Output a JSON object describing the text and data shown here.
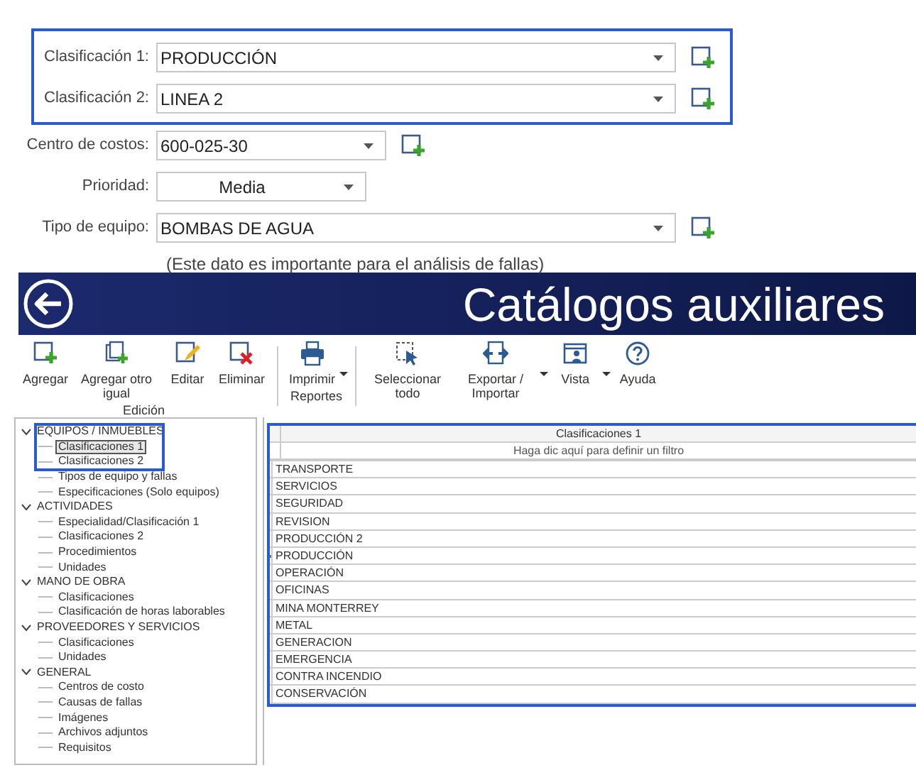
{
  "form": {
    "fields": [
      {
        "label": "Clasificación 1:",
        "value": "PRODUCCIÓN",
        "add_button": true,
        "highlighted": true
      },
      {
        "label": "Clasificación 2:",
        "value": "LINEA 2",
        "add_button": true,
        "highlighted": true
      },
      {
        "label": "Centro de costos:",
        "value": "600-025-30",
        "add_button": true,
        "highlighted": false
      },
      {
        "label": "Prioridad:",
        "value": "Media",
        "add_button": false,
        "highlighted": false
      },
      {
        "label": "Tipo de equipo:",
        "value": "BOMBAS DE AGUA",
        "add_button": true,
        "highlighted": false
      }
    ],
    "note": "(Este dato es importante para el análisis de fallas)"
  },
  "header": {
    "title": "Catálogos auxiliares"
  },
  "toolbar": {
    "groups": [
      {
        "label": "Edición",
        "buttons": [
          {
            "label": "Agregar",
            "has_menu": false
          },
          {
            "label": "Agregar otro igual",
            "has_menu": false
          },
          {
            "label": "Editar",
            "has_menu": false
          },
          {
            "label": "Eliminar",
            "has_menu": false
          }
        ]
      },
      {
        "label": "Reportes",
        "buttons": [
          {
            "label": "Imprimir",
            "has_menu": true
          }
        ]
      },
      {
        "buttons": [
          {
            "label": "Seleccionar todo",
            "has_menu": false
          },
          {
            "label": "Exportar / Importar",
            "has_menu": true
          },
          {
            "label": "Vista",
            "has_menu": true
          },
          {
            "label": "Ayuda",
            "has_menu": false
          }
        ]
      }
    ]
  },
  "tree": [
    {
      "label": "EQUIPOS / INMUEBLES",
      "expanded": true,
      "children": [
        {
          "label": "Clasificaciones 1",
          "selected": true,
          "highlighted": true
        },
        {
          "label": "Clasificaciones 2",
          "selected": false,
          "highlighted": true
        },
        {
          "label": "Tipos de equipo y fallas",
          "selected": false,
          "highlighted": false
        },
        {
          "label": "Especificaciones (Solo equipos)",
          "selected": false,
          "highlighted": false
        }
      ]
    },
    {
      "label": "ACTIVIDADES",
      "expanded": true,
      "children": [
        {
          "label": "Especialidad/Clasificación 1",
          "selected": false,
          "highlighted": false
        },
        {
          "label": "Clasificaciones 2",
          "selected": false,
          "highlighted": false
        },
        {
          "label": "Procedimientos",
          "selected": false,
          "highlighted": false
        },
        {
          "label": "Unidades",
          "selected": false,
          "highlighted": false
        }
      ]
    },
    {
      "label": "MANO DE OBRA",
      "expanded": true,
      "children": [
        {
          "label": "Clasificaciones",
          "selected": false,
          "highlighted": false
        },
        {
          "label": "Clasificación de horas laborables",
          "selected": false,
          "highlighted": false
        }
      ]
    },
    {
      "label": "PROVEEDORES Y SERVICIOS",
      "expanded": true,
      "children": [
        {
          "label": "Clasificaciones",
          "selected": false,
          "highlighted": false
        },
        {
          "label": "Unidades",
          "selected": false,
          "highlighted": false
        }
      ]
    },
    {
      "label": "GENERAL",
      "expanded": true,
      "children": [
        {
          "label": "Centros de costo",
          "selected": false,
          "highlighted": false
        },
        {
          "label": "Causas de fallas",
          "selected": false,
          "highlighted": false
        },
        {
          "label": "Imágenes",
          "selected": false,
          "highlighted": false
        },
        {
          "label": "Archivos adjuntos",
          "selected": false,
          "highlighted": false
        },
        {
          "label": "Requisitos",
          "selected": false,
          "highlighted": false
        }
      ]
    }
  ],
  "table": {
    "columns": [
      "Clasificaciones 1"
    ],
    "filter_placeholder": "Haga dic aquí para definir un filtro",
    "rows": [
      {
        "cells": [
          "TRANSPORTE"
        ],
        "focused": false
      },
      {
        "cells": [
          "SERVICIOS"
        ],
        "focused": false
      },
      {
        "cells": [
          "SEGURIDAD"
        ],
        "focused": false
      },
      {
        "cells": [
          "REVISION"
        ],
        "focused": false
      },
      {
        "cells": [
          "PRODUCCIÓN 2"
        ],
        "focused": false
      },
      {
        "cells": [
          "PRODUCCIÓN"
        ],
        "focused": true
      },
      {
        "cells": [
          "OPERACIÓN"
        ],
        "focused": false
      },
      {
        "cells": [
          "OFICINAS"
        ],
        "focused": false
      },
      {
        "cells": [
          "MINA MONTERREY"
        ],
        "focused": false
      },
      {
        "cells": [
          "METAL"
        ],
        "focused": false
      },
      {
        "cells": [
          "GENERACION"
        ],
        "focused": false
      },
      {
        "cells": [
          "EMERGENCIA"
        ],
        "focused": false
      },
      {
        "cells": [
          "CONTRA INCENDIO"
        ],
        "focused": false
      },
      {
        "cells": [
          "CONSERVACIÓN"
        ],
        "focused": false
      }
    ],
    "highlighted": true
  }
}
